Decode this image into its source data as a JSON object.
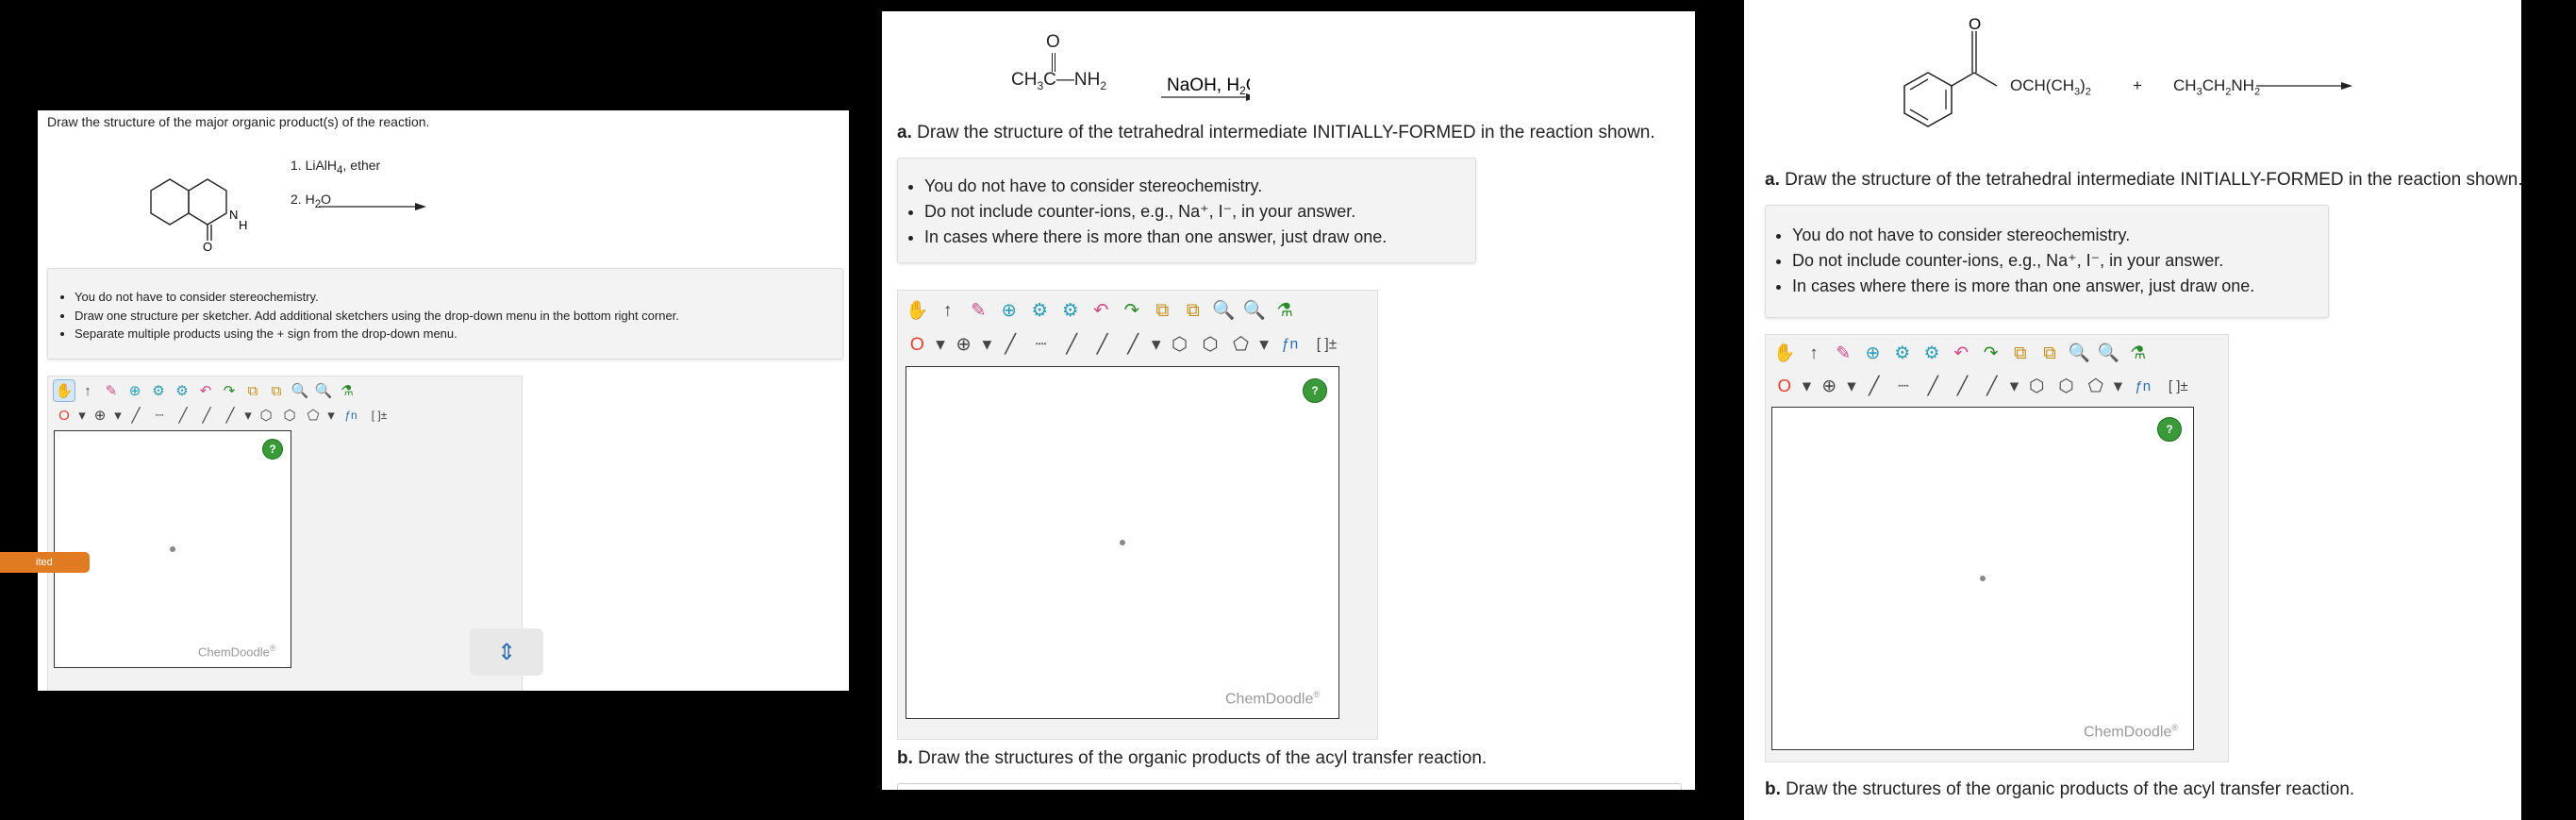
{
  "panel1": {
    "prompt": "Draw the structure of the major organic product(s) of the reaction.",
    "reagents": {
      "step1": "1. LiAlH",
      "step1_sub": "4",
      "step1_tail": ", ether",
      "step2": "2. H",
      "step2_sub": "2",
      "step2_tail": "O"
    },
    "atom_labels": {
      "nitrogen": "N",
      "hydrogen": "H",
      "oxygen": "O"
    },
    "bullets": [
      "You do not have to consider stereochemistry.",
      "Draw one structure per sketcher. Add additional sketchers using the drop-down menu in the bottom right corner.",
      "Separate multiple products using the + sign from the drop-down menu."
    ],
    "brand": "ChemDoodle",
    "tab_label": "ited"
  },
  "panel2": {
    "reactant": {
      "o": "O",
      "left": "CH",
      "left_sub": "3",
      "c": "C",
      "right": "NH",
      "right_sub": "2"
    },
    "reagent": "NaOH, H",
    "reagent_sub": "2",
    "reagent_tail": "O",
    "part_a_label": "a.",
    "part_a_text": "Draw the structure of the tetrahedral intermediate INITIALLY-FORMED in the reaction shown.",
    "bullets": [
      "You do not have to consider stereochemistry.",
      "Do not include counter-ions, e.g., Na⁺, I⁻, in your answer.",
      "In cases where there is more than one answer, just draw one."
    ],
    "brand": "ChemDoodle",
    "part_b_label": "b.",
    "part_b_text": "Draw the structures of the organic products of the acyl transfer reaction."
  },
  "panel3": {
    "reactant_o": "O",
    "reactant_ester": "OCH(CH",
    "reactant_ester_sub": "3",
    "reactant_ester_tail": ")",
    "reactant_ester_sub2": "2",
    "plus": "+",
    "amine": "CH",
    "amine_sub1": "3",
    "amine_mid": "CH",
    "amine_sub2": "2",
    "amine_tail": "NH",
    "amine_sub3": "2",
    "part_a_label": "a.",
    "part_a_text": "Draw the structure of the tetrahedral intermediate INITIALLY-FORMED in the reaction shown.",
    "bullets": [
      "You do not have to consider stereochemistry.",
      "Do not include counter-ions, e.g., Na⁺, I⁻, in your answer.",
      "In cases where there is more than one answer, just draw one."
    ],
    "brand": "ChemDoodle",
    "part_b_label": "b.",
    "part_b_text": "Draw the structures of the organic products of the acyl transfer reaction."
  },
  "toolbar": {
    "row1": [
      "✋",
      "↑",
      "✎",
      "⊕",
      "⚙",
      "⚙",
      "↶",
      "↷",
      "⧉",
      "⧉",
      "🔍",
      "🔍",
      "⚗"
    ],
    "row2": [
      "O",
      "▾",
      "⊕",
      "▾",
      "╱",
      "┈",
      "╱",
      "╱",
      "╱",
      "▾",
      "⬡",
      "⬡",
      "⬠",
      "▾",
      "ƒn",
      "[ ]±"
    ],
    "help": "?"
  }
}
